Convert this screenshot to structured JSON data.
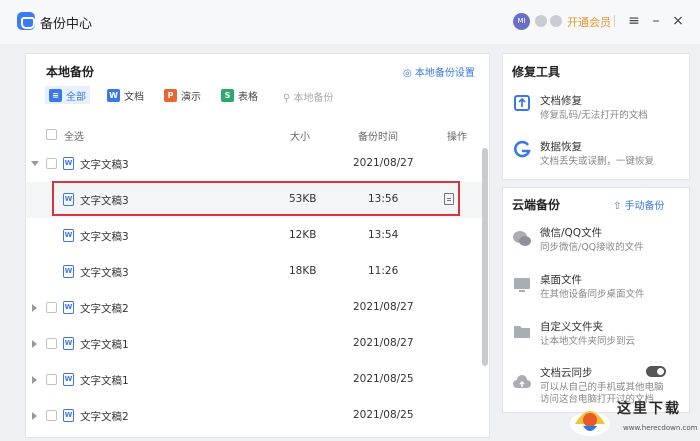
{
  "app": {
    "title": "备份中心",
    "avatar_text": "MI",
    "vip_label": "开通会员"
  },
  "window_controls": {
    "menu": "≡",
    "minimize": "–",
    "close": "×"
  },
  "local": {
    "title": "本地备份",
    "settings_link": "本地备份设置",
    "filters": [
      {
        "label": "全部",
        "icon": "≡",
        "color": "#3a78e8"
      },
      {
        "label": "文档",
        "icon": "W",
        "color": "#3a78e8"
      },
      {
        "label": "演示",
        "icon": "P",
        "color": "#e8672e"
      },
      {
        "label": "表格",
        "icon": "S",
        "color": "#2ea86b"
      }
    ],
    "search_placeholder": "本地备份",
    "headers": {
      "select_all": "全选",
      "size": "大小",
      "time": "备份时间",
      "action": "操作"
    },
    "rows": [
      {
        "name": "文字文稿3",
        "size": "",
        "time": "2021/08/27",
        "kind": "group-open"
      },
      {
        "name": "文字文稿3",
        "size": "53KB",
        "time": "13:56",
        "kind": "child"
      },
      {
        "name": "文字文稿3",
        "size": "12KB",
        "time": "13:54",
        "kind": "child"
      },
      {
        "name": "文字文稿3",
        "size": "18KB",
        "time": "11:26",
        "kind": "child"
      },
      {
        "name": "文字文稿2",
        "size": "",
        "time": "2021/08/27",
        "kind": "group"
      },
      {
        "name": "文字文稿1",
        "size": "",
        "time": "2021/08/27",
        "kind": "group"
      },
      {
        "name": "文字文稿1",
        "size": "",
        "time": "2021/08/25",
        "kind": "group"
      },
      {
        "name": "文字文稿2",
        "size": "",
        "time": "2021/08/25",
        "kind": "group"
      }
    ]
  },
  "repair": {
    "title": "修复工具",
    "tools": [
      {
        "name": "文档修复",
        "desc": "修复乱码/无法打开的文档",
        "icon": "repair-icon"
      },
      {
        "name": "数据恢复",
        "desc": "文档丢失或误删，一键恢复",
        "icon": "recover-icon"
      }
    ]
  },
  "cloud": {
    "title": "云端备份",
    "manual_link": "手动备份",
    "items": [
      {
        "name": "微信/QQ文件",
        "desc": "同步微信/QQ接收的文件",
        "icon": "chat-icon"
      },
      {
        "name": "桌面文件",
        "desc": "在其他设备同步桌面文件",
        "icon": "desktop-icon"
      },
      {
        "name": "自定义文件夹",
        "desc": "让本地文件夹同步到云",
        "icon": "folder-icon"
      },
      {
        "name": "文档云同步",
        "desc": "可以从自己的手机或其他电脑",
        "desc2": "访问这台电脑打开过的文档",
        "icon": "cloud-sync-icon"
      }
    ]
  },
  "watermark": {
    "text": "这里下载",
    "url": "www.herecdown.com"
  }
}
